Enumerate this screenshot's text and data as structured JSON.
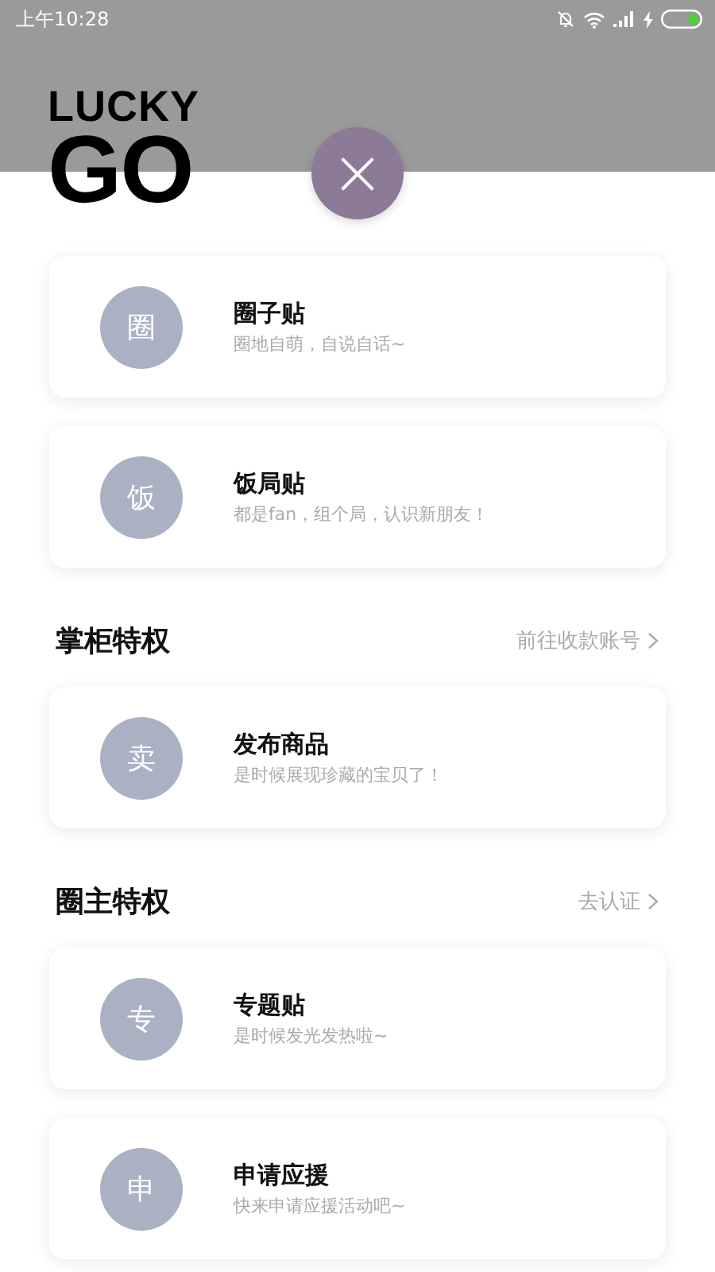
{
  "status_bar": {
    "time": "上午10:28"
  },
  "logo": {
    "line_1": "LUCKY",
    "line_2": "GO"
  },
  "close_button": {
    "label": "×"
  },
  "sections": [
    {
      "items": [
        {
          "badge": "圈",
          "title": "圈子贴",
          "subtitle": "圈地自萌，自说自话~"
        },
        {
          "badge": "饭",
          "title": "饭局贴",
          "subtitle": "都是fan，组个局，认识新朋友！"
        }
      ]
    },
    {
      "title": "掌柜特权",
      "link": "前往收款账号",
      "items": [
        {
          "badge": "卖",
          "title": "发布商品",
          "subtitle": "是时候展现珍藏的宝贝了！"
        }
      ]
    },
    {
      "title": "圈主特权",
      "link": "去认证",
      "items": [
        {
          "badge": "专",
          "title": "专题贴",
          "subtitle": "是时候发光发热啦~"
        },
        {
          "badge": "申",
          "title": "申请应援",
          "subtitle": "快来申请应援活动吧~"
        }
      ]
    }
  ]
}
